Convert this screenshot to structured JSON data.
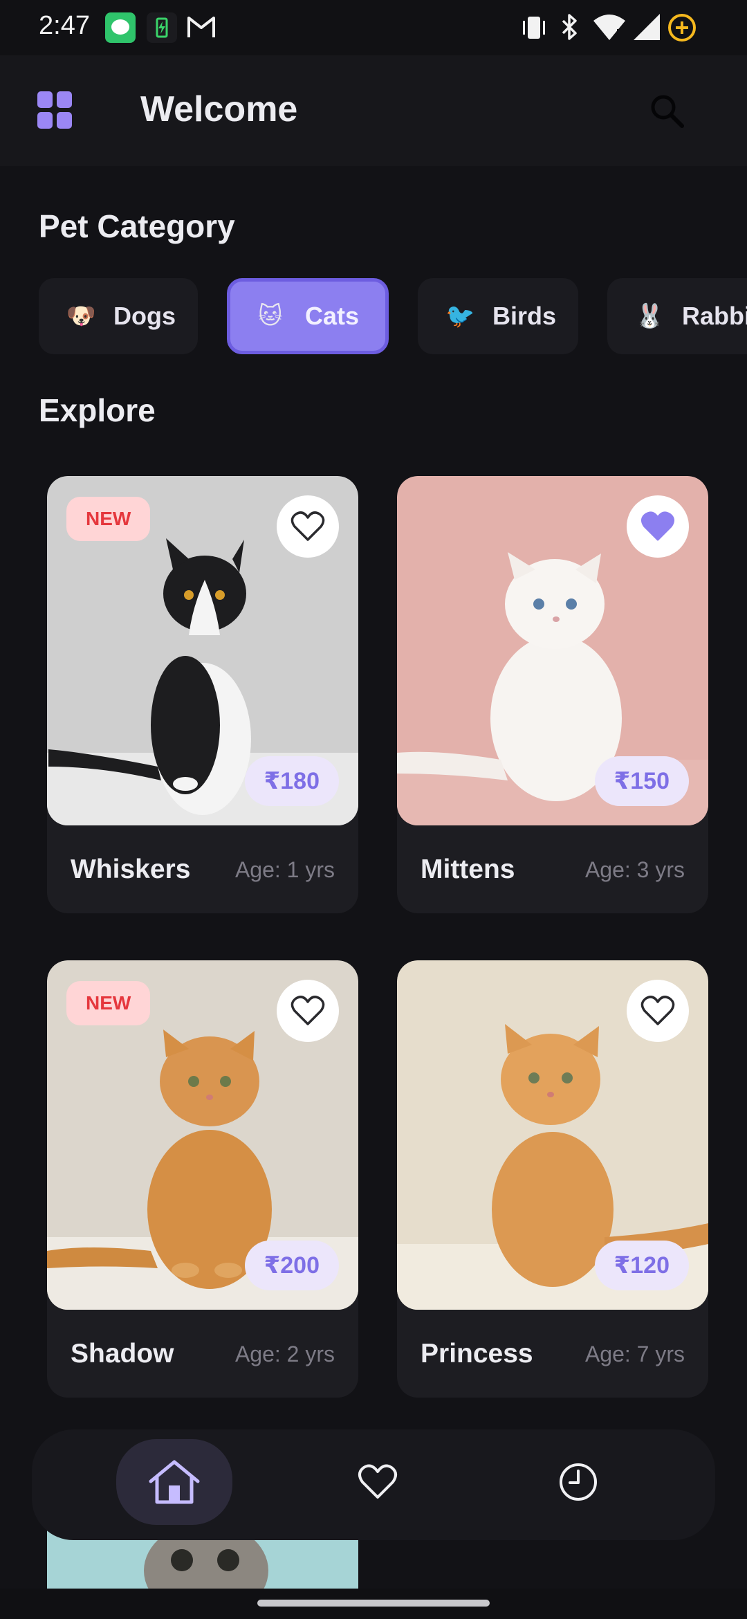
{
  "status_bar": {
    "time": "2:47"
  },
  "header": {
    "title": "Welcome"
  },
  "category_section": {
    "title": "Pet Category",
    "chips": [
      {
        "emoji": "🐶",
        "label": "Dogs",
        "selected": false
      },
      {
        "emoji": "🐱",
        "label": "Cats",
        "selected": true
      },
      {
        "emoji": "🐦",
        "label": "Birds",
        "selected": false
      },
      {
        "emoji": "🐰",
        "label": "Rabbits",
        "selected": false
      }
    ]
  },
  "explore_section": {
    "title": "Explore",
    "pets": [
      {
        "name": "Whiskers",
        "age": "Age: 1 yrs",
        "price": "₹180",
        "badge": "NEW",
        "favorite": false
      },
      {
        "name": "Mittens",
        "age": "Age: 3 yrs",
        "price": "₹150",
        "badge": "",
        "favorite": true
      },
      {
        "name": "Shadow",
        "age": "Age: 2 yrs",
        "price": "₹200",
        "badge": "NEW",
        "favorite": false
      },
      {
        "name": "Princess",
        "age": "Age: 7 yrs",
        "price": "₹120",
        "badge": "",
        "favorite": false
      }
    ]
  },
  "bottom_nav": {
    "items": [
      {
        "icon": "home-icon",
        "active": true
      },
      {
        "icon": "heart-icon",
        "active": false
      },
      {
        "icon": "clock-icon",
        "active": false
      }
    ]
  },
  "colors": {
    "accent": "#8c7ff0",
    "background": "#121216",
    "badge_new_bg": "#ffd5d6",
    "badge_new_text": "#e5373d",
    "price_bg": "#ece6fb"
  }
}
